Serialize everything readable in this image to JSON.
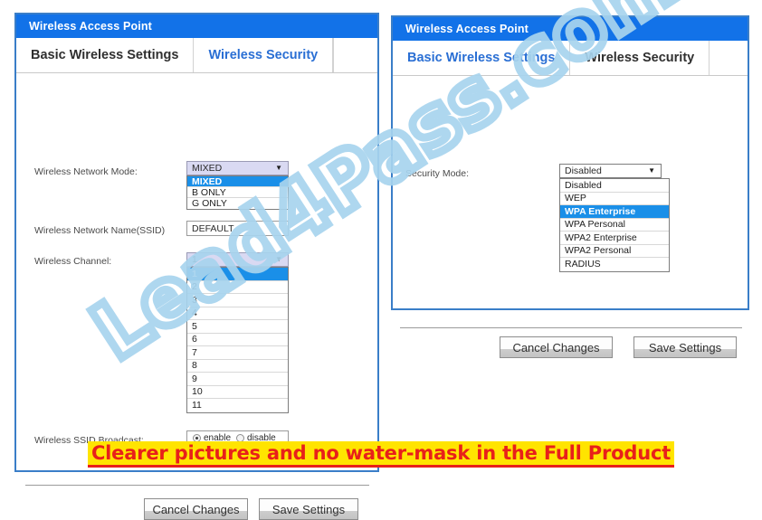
{
  "page": {
    "background_color": "#ffffff",
    "accent_blue": "#1272e8",
    "border_blue": "#3a7ec8",
    "highlight_blue": "#1a8fe8",
    "select_fill": "#d9d9f2"
  },
  "watermark": {
    "text": "Lead4Pass.com",
    "color": "#a8d4ee"
  },
  "banner": {
    "text": "Clearer pictures and no water-mask in the Full Product",
    "text_color": "#e8201a",
    "highlight_color": "#ffe400"
  },
  "left_panel": {
    "header_title": "Wireless Access Point",
    "tabs": [
      {
        "label": "Basic Wireless Settings",
        "state": "active"
      },
      {
        "label": "Wireless Security",
        "state": "inactive"
      }
    ],
    "fields": {
      "network_mode": {
        "label": "Wireless Network Mode:",
        "value": "MIXED",
        "caret": "▼",
        "options": [
          "MIXED",
          "B ONLY",
          "G ONLY"
        ],
        "selected": "MIXED",
        "open": true
      },
      "ssid": {
        "label": "Wireless Network Name(SSID)",
        "value": "DEFAULT",
        "placeholder": "DEFAULT"
      },
      "channel": {
        "label": "Wireless Channel:",
        "value": "1",
        "caret": "▼",
        "options": [
          "1",
          "2",
          "3",
          "4",
          "5",
          "6",
          "7",
          "8",
          "9",
          "10",
          "11"
        ],
        "selected": "1",
        "open": true
      },
      "ssid_broadcast": {
        "label": "Wireless SSID Broadcast:",
        "options": [
          {
            "label": "enable",
            "checked": true
          },
          {
            "label": "disable",
            "checked": false
          }
        ]
      }
    },
    "buttons": [
      {
        "label": "Cancel Changes"
      },
      {
        "label": "Save Settings"
      }
    ]
  },
  "right_panel": {
    "header_title": "Wireless Access Point",
    "tabs": [
      {
        "label": "Basic Wireless Settings",
        "state": "inactive"
      },
      {
        "label": "Wireless Security",
        "state": "active"
      }
    ],
    "fields": {
      "security_mode": {
        "label": "Security Mode:",
        "value": "Disabled",
        "caret": "▼",
        "options": [
          "Disabled",
          "WEP",
          "WPA Enterprise",
          "WPA Personal",
          "WPA2 Enterprise",
          "WPA2 Personal",
          "RADIUS"
        ],
        "selected": "WPA Enterprise",
        "open": true
      }
    },
    "buttons": [
      {
        "label": "Cancel Changes"
      },
      {
        "label": "Save Settings"
      }
    ]
  }
}
